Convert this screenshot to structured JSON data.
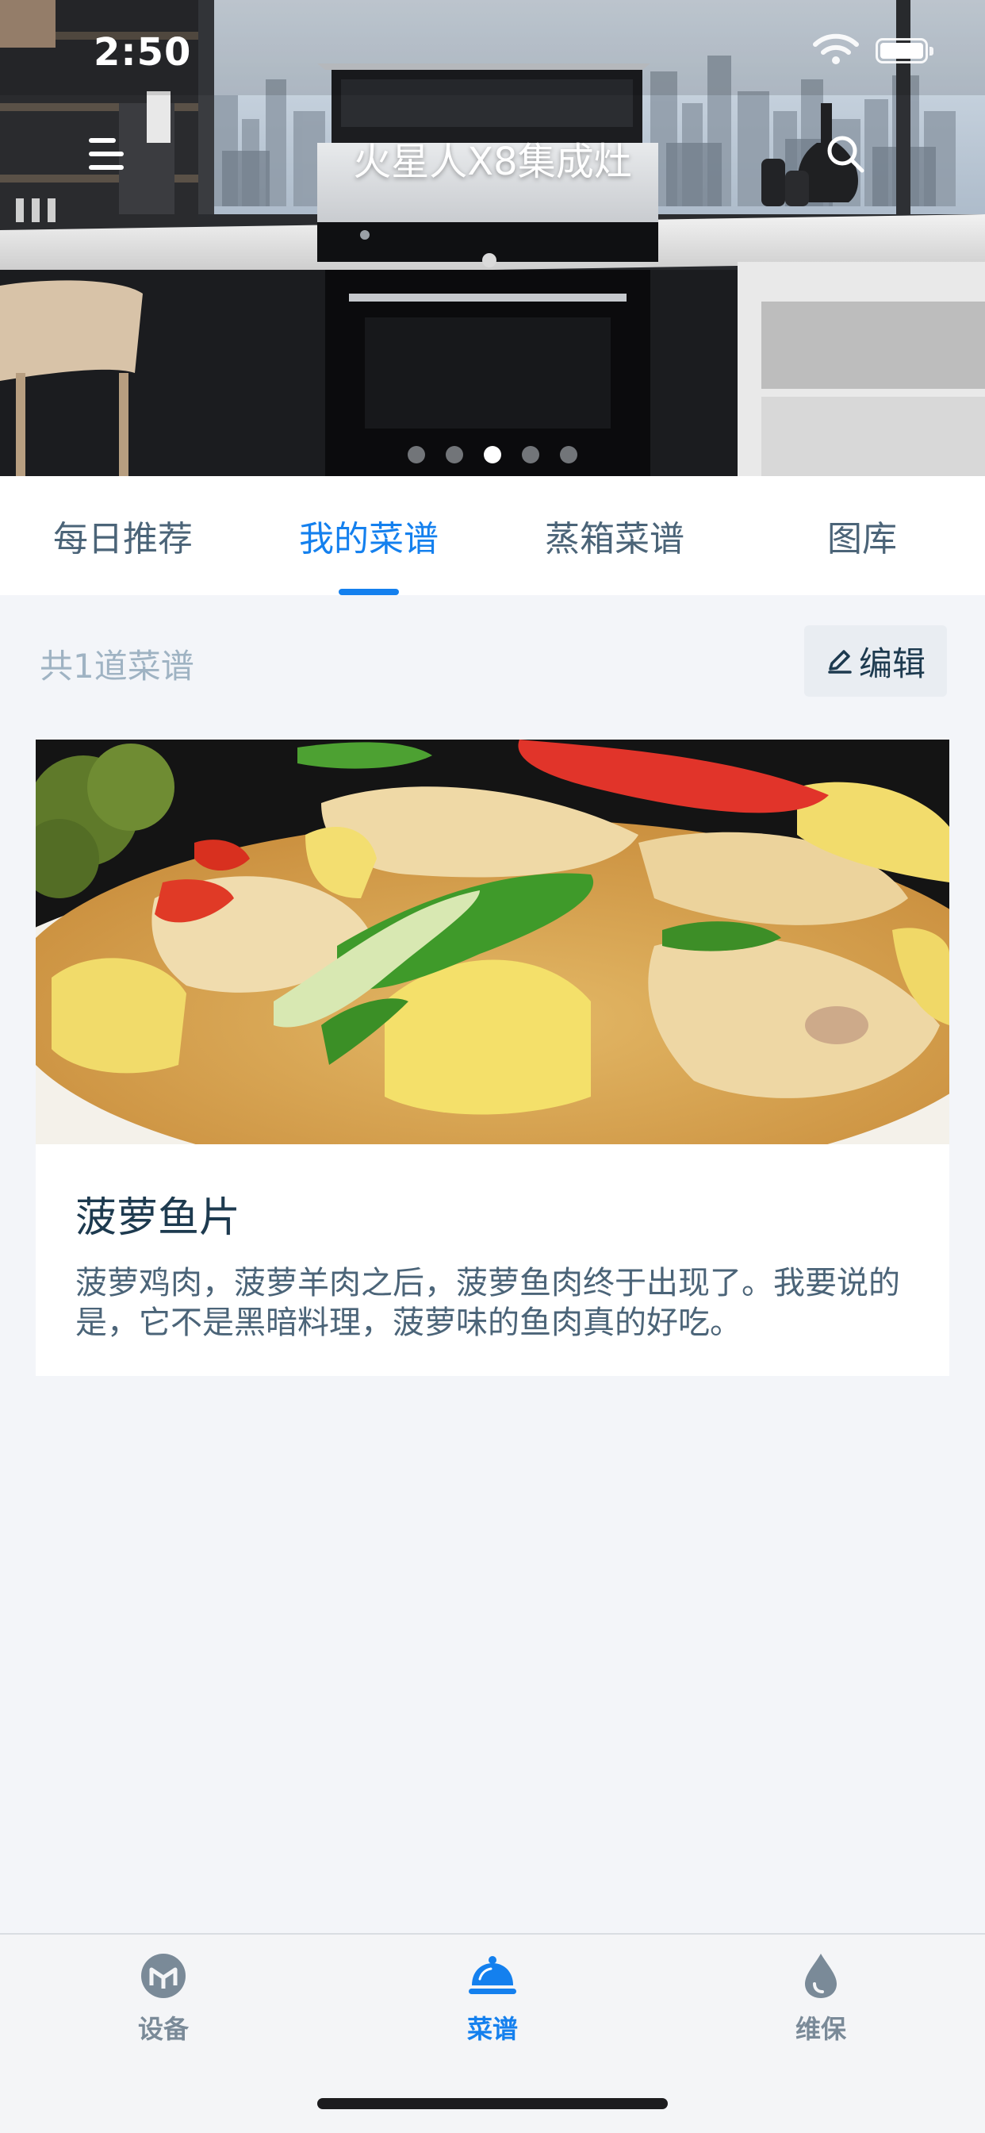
{
  "status_bar": {
    "time": "2:50"
  },
  "header": {
    "title": "火星人X8集成灶",
    "menu_icon": "menu-icon",
    "search_icon": "search-icon"
  },
  "banner": {
    "slide_count": 5,
    "active_slide": 3
  },
  "tabs": [
    {
      "label": "每日推荐",
      "active": false
    },
    {
      "label": "我的菜谱",
      "active": true
    },
    {
      "label": "蒸箱菜谱",
      "active": false
    },
    {
      "label": "图库",
      "active": false
    }
  ],
  "recipes_header": {
    "count_text": "共1道菜谱",
    "edit_label": "编辑",
    "edit_icon": "pencil-icon"
  },
  "recipes": [
    {
      "title": "菠萝鱼片",
      "description": "菠萝鸡肉，菠萝羊肉之后，菠萝鱼肉终于出现了。我要说的是，它不是黑暗料理，菠萝味的鱼肉真的好吃。"
    }
  ],
  "bottom_nav": [
    {
      "label": "设备",
      "icon": "device-icon",
      "active": false
    },
    {
      "label": "菜谱",
      "icon": "cloche-icon",
      "active": true
    },
    {
      "label": "维保",
      "icon": "water-drop-icon",
      "active": false
    }
  ],
  "colors": {
    "accent": "#1480ee",
    "text_primary": "#1d3a4f",
    "text_secondary": "#4b6478",
    "text_muted": "#9fb3c3",
    "nav_inactive": "#7a8a98",
    "page_background": "#f3f5f9"
  }
}
